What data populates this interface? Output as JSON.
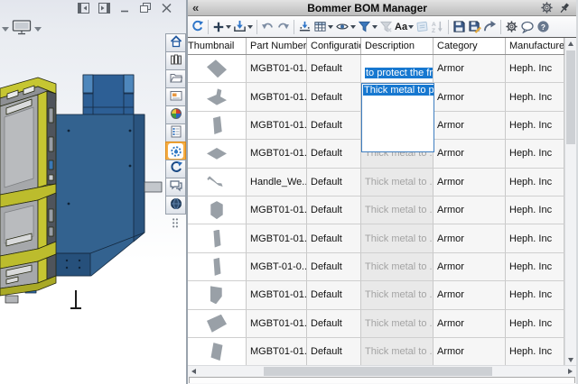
{
  "window_controls": {
    "icons": [
      "dock-left-icon",
      "dock-right-icon",
      "minimize-icon",
      "restore-icon",
      "close-icon"
    ]
  },
  "viewport": {
    "hud_icons": [
      "dropdown-caret",
      "display-settings-icon",
      "dropdown-caret"
    ],
    "model": "yellow frame cage assembly with blue armor box"
  },
  "task_pane": {
    "tabs": [
      "home",
      "resources",
      "design-library",
      "view-palette",
      "appearances",
      "custom-properties",
      "bommer",
      "sync",
      "comments",
      "web"
    ],
    "active_tab": "bommer",
    "active_tab_color": "#f6ad42"
  },
  "bom_panel": {
    "collapse_label": "«",
    "title": "Bommer BOM Manager",
    "titlebar_icons": [
      "settings-gear-icon",
      "pin-icon"
    ],
    "toolbar": {
      "icons": [
        "refresh",
        "add",
        "import",
        "undo",
        "redo",
        "autofit",
        "columns",
        "visibility",
        "filter",
        "clear-filter",
        "text-format",
        "edit-notes",
        "sort",
        "save",
        "save-as",
        "share",
        "settings",
        "feedback",
        "help"
      ],
      "text_format_label": "Aa"
    },
    "table": {
      "columns": [
        "Thumbnail",
        "Part Number",
        "Configuration",
        "Description",
        "Category",
        "Manufacturer"
      ],
      "edit_text": "Thick metal to prote",
      "selection_color": "#1778d0",
      "rows": [
        {
          "thumbnail": "angled-plate",
          "part_number": "MGBT01-01...",
          "configuration": "Default",
          "description": "to protect the frame",
          "desc_style": "selected",
          "category": "Armor",
          "manufacturer": "Heph. Inc"
        },
        {
          "thumbnail": "angle-bracket",
          "part_number": "MGBT01-01...",
          "configuration": "Default",
          "description": "",
          "desc_style": "editing",
          "category": "Armor",
          "manufacturer": "Heph. Inc"
        },
        {
          "thumbnail": "vertical-plate",
          "part_number": "MGBT01-01...",
          "configuration": "Default",
          "description": "",
          "desc_style": "editing",
          "category": "Armor",
          "manufacturer": "Heph. Inc"
        },
        {
          "thumbnail": "flat-plate",
          "part_number": "MGBT01-01...",
          "configuration": "Default",
          "description": "Thick metal to ...",
          "desc_style": "muted",
          "category": "Armor",
          "manufacturer": "Heph. Inc"
        },
        {
          "thumbnail": "handle",
          "part_number": "Handle_We...",
          "configuration": "Default",
          "description": "Thick metal to ...",
          "desc_style": "muted",
          "category": "Armor",
          "manufacturer": "Heph. Inc"
        },
        {
          "thumbnail": "hex-block",
          "part_number": "MGBT01-01...",
          "configuration": "Default",
          "description": "Thick metal to ...",
          "desc_style": "muted",
          "category": "Armor",
          "manufacturer": "Heph. Inc"
        },
        {
          "thumbnail": "tall-plate",
          "part_number": "MGBT01-01...",
          "configuration": "Default",
          "description": "Thick metal to ...",
          "desc_style": "muted",
          "category": "Armor",
          "manufacturer": "Heph. Inc"
        },
        {
          "thumbnail": "tall-plate",
          "part_number": "MGBT-01-0...",
          "configuration": "Default",
          "description": "Thick metal to ...",
          "desc_style": "muted",
          "category": "Armor",
          "manufacturer": "Heph. Inc"
        },
        {
          "thumbnail": "bent-plate",
          "part_number": "MGBT01-01...",
          "configuration": "Default",
          "description": "Thick metal to ...",
          "desc_style": "muted",
          "category": "Armor",
          "manufacturer": "Heph. Inc"
        },
        {
          "thumbnail": "wide-plate",
          "part_number": "MGBT01-01...",
          "configuration": "Default",
          "description": "Thick metal to ...",
          "desc_style": "muted",
          "category": "Armor",
          "manufacturer": "Heph. Inc"
        },
        {
          "thumbnail": "para-plate",
          "part_number": "MGBT01-01...",
          "configuration": "Default",
          "description": "Thick metal to ...",
          "desc_style": "muted",
          "category": "Armor",
          "manufacturer": "Heph. Inc"
        }
      ]
    }
  }
}
